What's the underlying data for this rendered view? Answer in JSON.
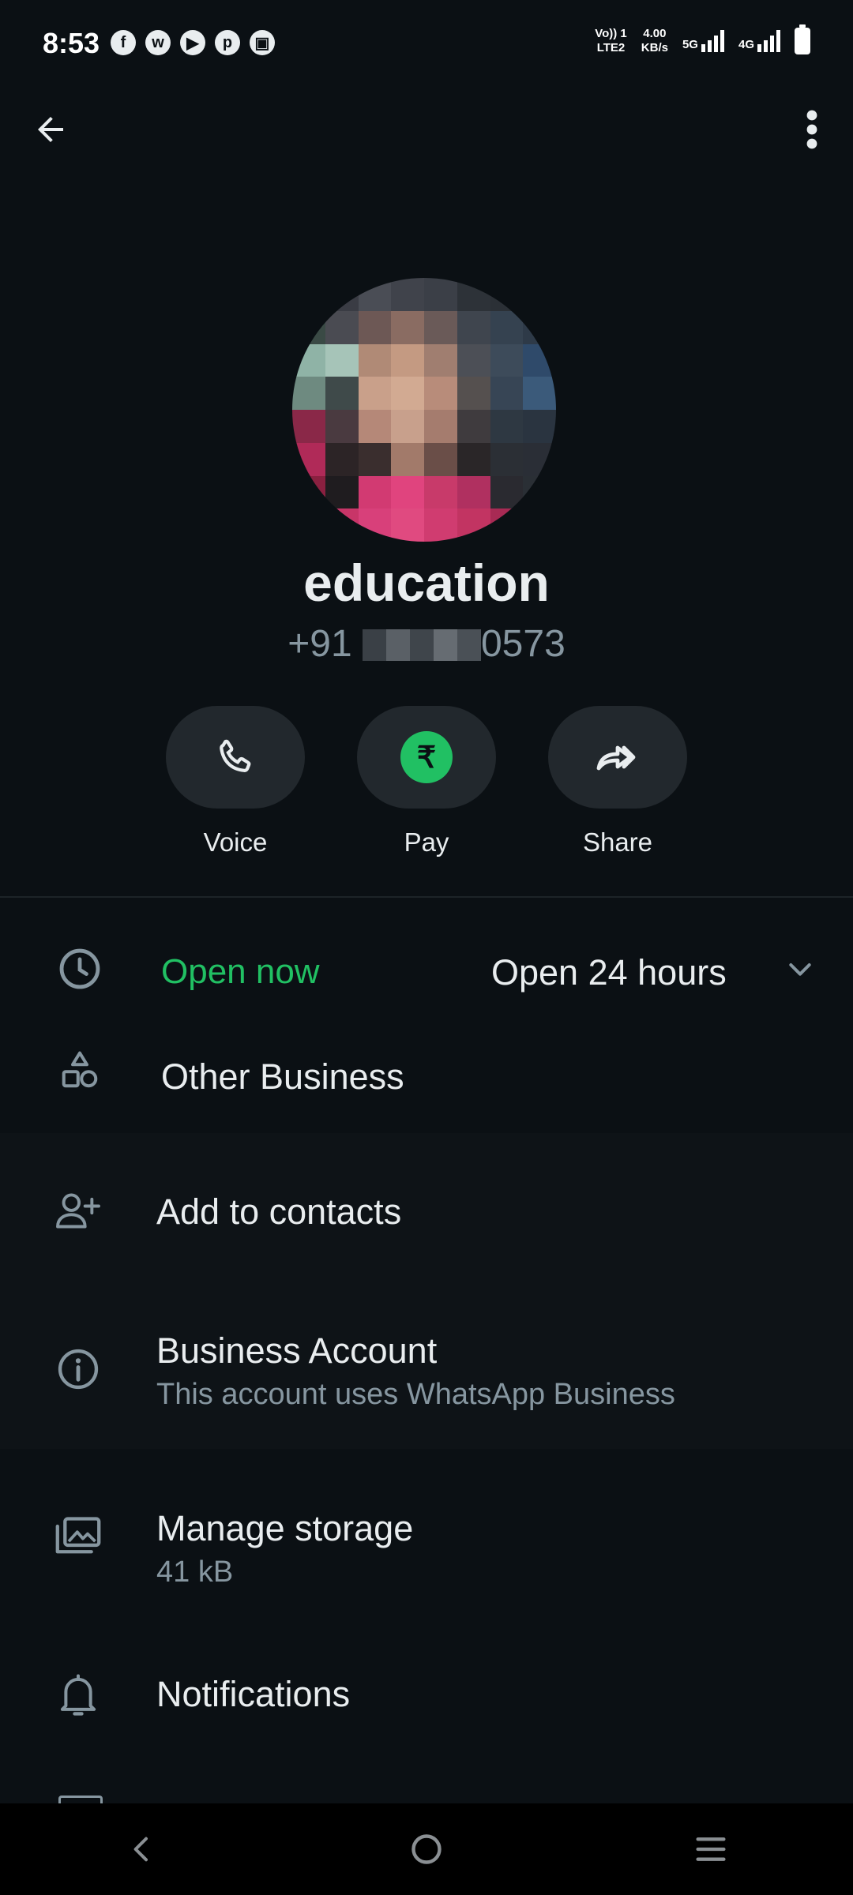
{
  "status_bar": {
    "time": "8:53",
    "apps": [
      "f",
      "w",
      "▶",
      "p",
      "▣"
    ],
    "volte": "Vo)) 1",
    "lte": "LTE2",
    "speed": "4.00",
    "speed_unit": "KB/s",
    "net1": "5G",
    "net2": "4G"
  },
  "profile": {
    "name": "education",
    "phone_prefix": "+91",
    "phone_suffix": "0573"
  },
  "actions": [
    {
      "label": "Voice",
      "icon": "phone-icon"
    },
    {
      "label": "Pay",
      "icon": "rupee-icon"
    },
    {
      "label": "Share",
      "icon": "share-icon"
    }
  ],
  "hours": {
    "status": "Open now",
    "schedule": "Open 24 hours"
  },
  "category": "Other Business",
  "add_contact": "Add to contacts",
  "business": {
    "title": "Business Account",
    "subtitle": "This account uses WhatsApp Business"
  },
  "storage": {
    "title": "Manage storage",
    "size": "41 kB"
  },
  "notifications": "Notifications",
  "colors": {
    "background": "#0b1014",
    "accent_green": "#21c063",
    "secondary_text": "#8696a0"
  }
}
